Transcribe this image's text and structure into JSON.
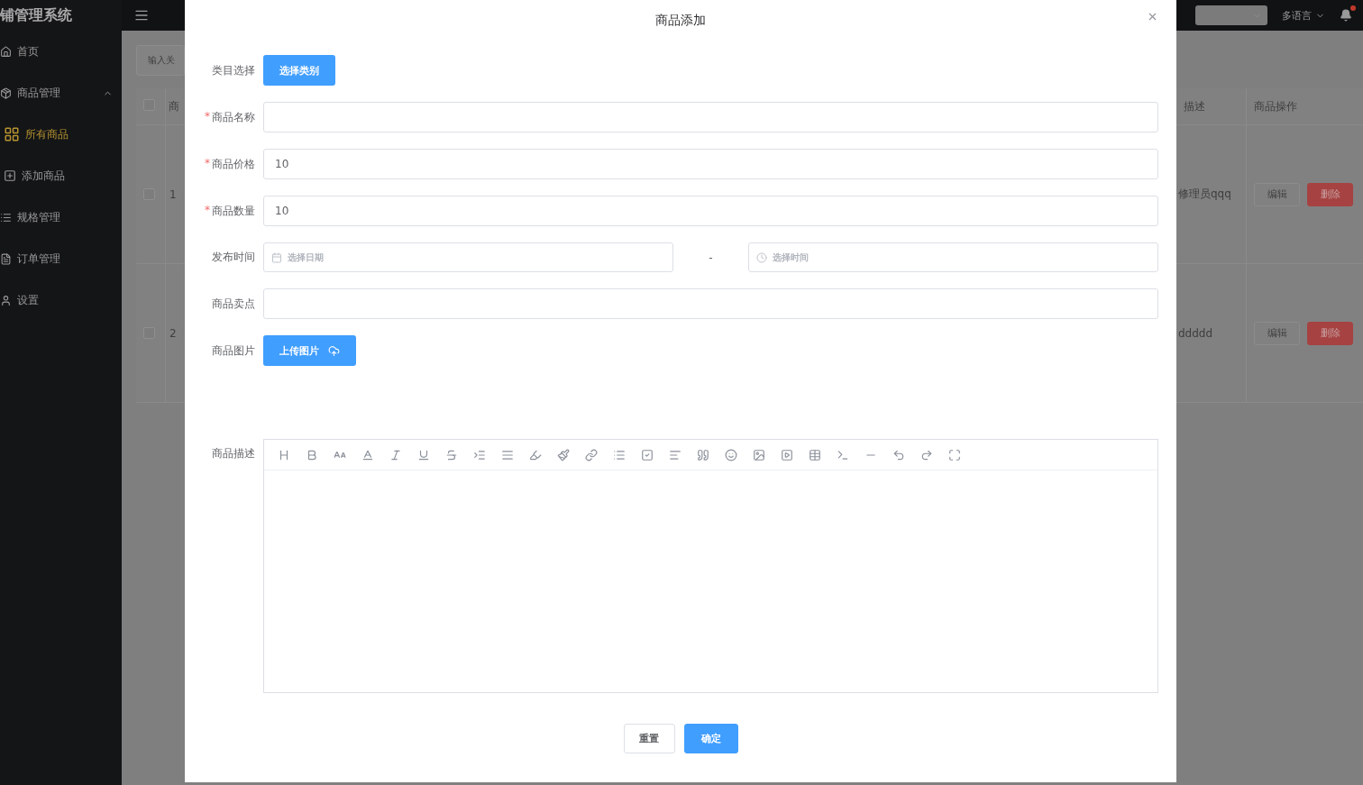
{
  "brand": {
    "title": "铺管理系统"
  },
  "sidebar": {
    "items": [
      {
        "label": "首页",
        "kind": "link",
        "selected": false
      },
      {
        "label": "商品管理",
        "kind": "group",
        "expanded": true,
        "children": [
          {
            "label": "所有商品",
            "selected": true
          },
          {
            "label": "添加商品",
            "selected": false
          }
        ]
      },
      {
        "label": "规格管理",
        "kind": "link",
        "selected": false
      },
      {
        "label": "订单管理",
        "kind": "link",
        "selected": false
      },
      {
        "label": "设置",
        "kind": "link",
        "selected": false
      }
    ]
  },
  "header": {
    "language": "多语言",
    "has_notification": true
  },
  "background": {
    "search_placeholder": "输入关",
    "header_checked": false,
    "columns": [
      "商",
      "描述",
      "商品操作"
    ],
    "rows": [
      {
        "checked": false,
        "column_2": "1",
        "description": "修理员qqq",
        "actions": [
          {
            "label": "编辑",
            "kind": "default"
          },
          {
            "label": "删除",
            "kind": "danger"
          }
        ]
      },
      {
        "checked": false,
        "column_2": "2",
        "description": "ddddd",
        "actions": [
          {
            "label": "编辑",
            "kind": "default"
          },
          {
            "label": "删除",
            "kind": "danger"
          }
        ]
      }
    ]
  },
  "dialog": {
    "title": "商品添加",
    "fields": [
      {
        "kind": "button",
        "label": "类目选择",
        "button": "选择类别"
      },
      {
        "kind": "input",
        "label": "商品名称",
        "required_mark": "*"
      },
      {
        "kind": "input",
        "label": "商品价格",
        "required_mark": "*",
        "value": "10"
      },
      {
        "kind": "input",
        "label": "商品数量",
        "required_mark": "*",
        "value": "10"
      },
      {
        "kind": "daterange",
        "label": "发布时间",
        "date_placeholder": "选择日期",
        "separator": "-",
        "time_placeholder": "选择时间"
      },
      {
        "kind": "input",
        "label": "商品卖点"
      },
      {
        "kind": "upload",
        "label": "商品图片",
        "button": "上传图片"
      },
      {
        "kind": "editor",
        "label": "商品描述"
      }
    ],
    "buttons": [
      {
        "label": "重置",
        "primary": false
      },
      {
        "label": "确定",
        "primary": true
      }
    ]
  }
}
